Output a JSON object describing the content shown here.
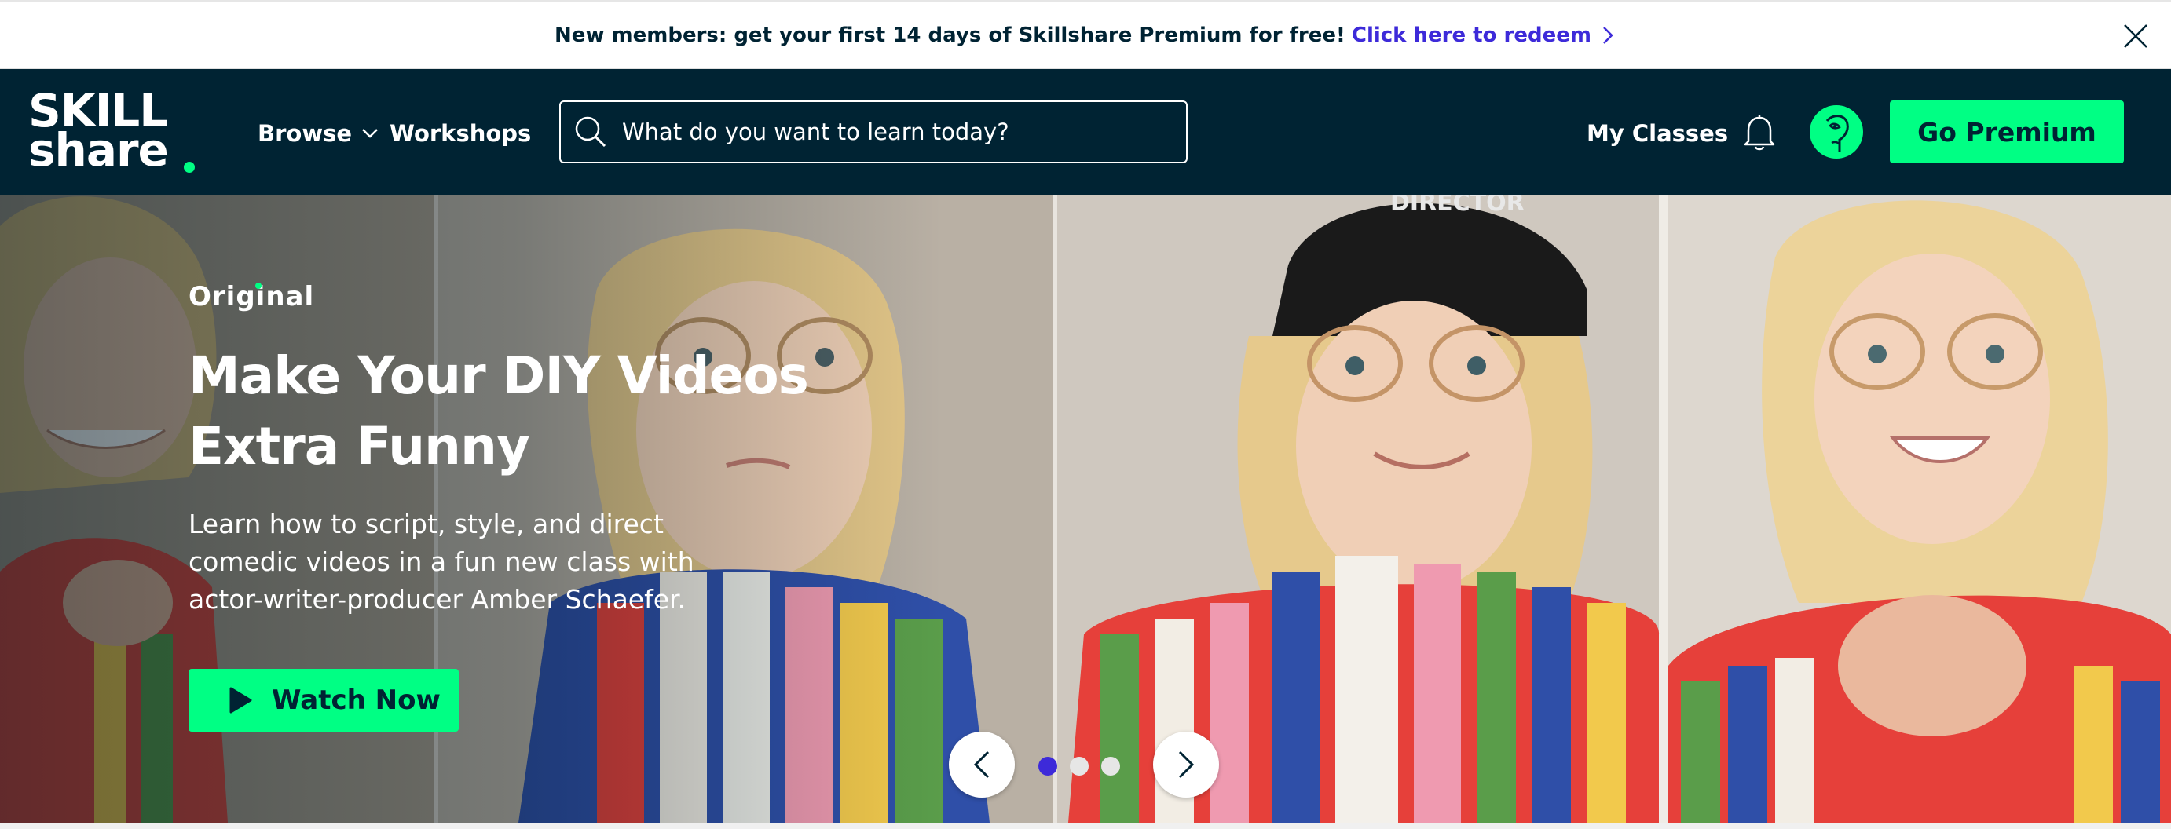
{
  "promo": {
    "text": "New members: get your first 14 days of Skillshare Premium for free!",
    "link": "Click here to redeem"
  },
  "header": {
    "logo_line1": "SKILL",
    "logo_line2": "share",
    "browse": "Browse",
    "workshops": "Workshops",
    "search_placeholder": "What do you want to learn today?",
    "my_classes": "My Classes",
    "go_premium": "Go Premium"
  },
  "hero": {
    "eyebrow": "Original",
    "title": "Make Your DIY Videos Extra Funny",
    "description": "Learn how to script, style, and direct comedic videos in a fun new class with actor-writer-producer Amber Schaefer.",
    "cta": "Watch Now",
    "cap_text": "DIRECTOR",
    "slides": 3,
    "active_slide": 1
  },
  "icons": [
    "chevron-right-icon",
    "close-icon",
    "chevron-down-icon",
    "search-icon",
    "bell-icon",
    "avatar-face-icon",
    "play-icon",
    "chevron-left-icon"
  ],
  "colors": {
    "brand_dark": "#002333",
    "brand_green": "#00ff84",
    "accent_purple": "#3d2ad9"
  }
}
